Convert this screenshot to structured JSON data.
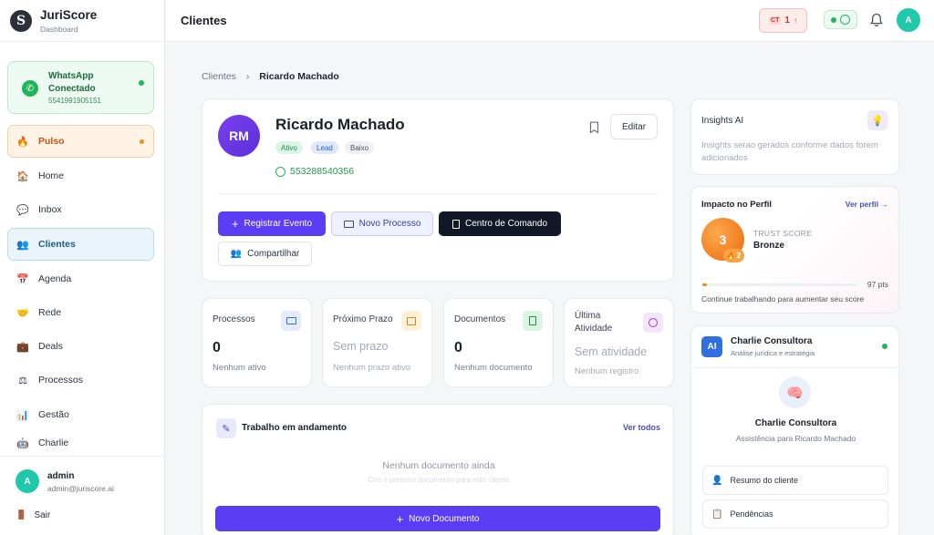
{
  "brand": {
    "title": "JuriScore",
    "subtitle": "Dashboard",
    "logo_letter": "S"
  },
  "whatsapp": {
    "title": "WhatsApp",
    "status": "Conectado",
    "number": "5541991905151"
  },
  "nav": [
    {
      "label": "Pulso",
      "icon": "flame-icon"
    },
    {
      "label": "Home",
      "icon": "home-icon"
    },
    {
      "label": "Inbox",
      "icon": "chat-icon"
    },
    {
      "label": "Clientes",
      "icon": "users-icon"
    },
    {
      "label": "Agenda",
      "icon": "calendar-icon"
    },
    {
      "label": "Rede",
      "icon": "handshake-icon"
    },
    {
      "label": "Deals",
      "icon": "briefcase-icon"
    },
    {
      "label": "Processos",
      "icon": "scales-icon"
    },
    {
      "label": "Gestão",
      "icon": "bar-chart-icon"
    },
    {
      "label": "Charlie",
      "icon": "robot-icon"
    }
  ],
  "user": {
    "initial": "A",
    "name": "admin",
    "email": "admin@juriscore.ai",
    "logout": "Sair"
  },
  "topbar": {
    "title": "Clientes",
    "ct_label": "CT",
    "ct_count": "1",
    "ct_arrow": "↑",
    "avatar": "A"
  },
  "breadcrumb": {
    "parent": "Clientes",
    "current": "Ricardo Machado"
  },
  "profile": {
    "initials": "RM",
    "name": "Ricardo Machado",
    "tags": [
      "Ativo",
      "Lead",
      "Baixo"
    ],
    "phone": "553288540356",
    "edit": "Editar",
    "actions": {
      "register": "Registrar Evento",
      "new_process": "Novo Processo",
      "command": "Centro de Comando",
      "share": "Compartilhar"
    }
  },
  "stats": [
    {
      "label": "Processos",
      "value": "0",
      "sub": "Nenhum ativo"
    },
    {
      "label": "Próximo Prazo",
      "value": "Sem prazo",
      "sub": "Nenhum prazo ativo"
    },
    {
      "label": "Documentos",
      "value": "0",
      "sub": "Nenhum documento"
    },
    {
      "label": "Última Atividade",
      "value": "Sem atividade",
      "sub": "Nenhum registro"
    }
  ],
  "work": {
    "title": "Trabalho em andamento",
    "link": "Ver todos",
    "empty": "Nenhum documento ainda",
    "empty_sub": "Crie o primeiro documento para este cliente",
    "button": "Novo Documento"
  },
  "insights": {
    "title": "Insights AI",
    "text": "Insights serao gerados conforme dados forem adicionados"
  },
  "impact": {
    "title": "Impacto no Perfil",
    "link": "Ver perfil →",
    "score": "3",
    "badge": "2",
    "label": "TRUST SCORE",
    "level": "Bronze",
    "points": "97 pts",
    "progress": 0.03,
    "hint": "Continue trabalhando para aumentar seu score"
  },
  "charlie": {
    "badge": "AI",
    "title": "Charlie Consultora",
    "subtitle": "Análise jurídica e estratégia",
    "name": "Charlie Consultora",
    "desc": "Assistência para Ricardo Machado",
    "quick": [
      "Resumo do cliente",
      "Pendências"
    ]
  },
  "colors": {
    "primary": "#5b3df5",
    "dark": "#111827",
    "green": "#22b45a",
    "orange": "#f08a2e"
  }
}
